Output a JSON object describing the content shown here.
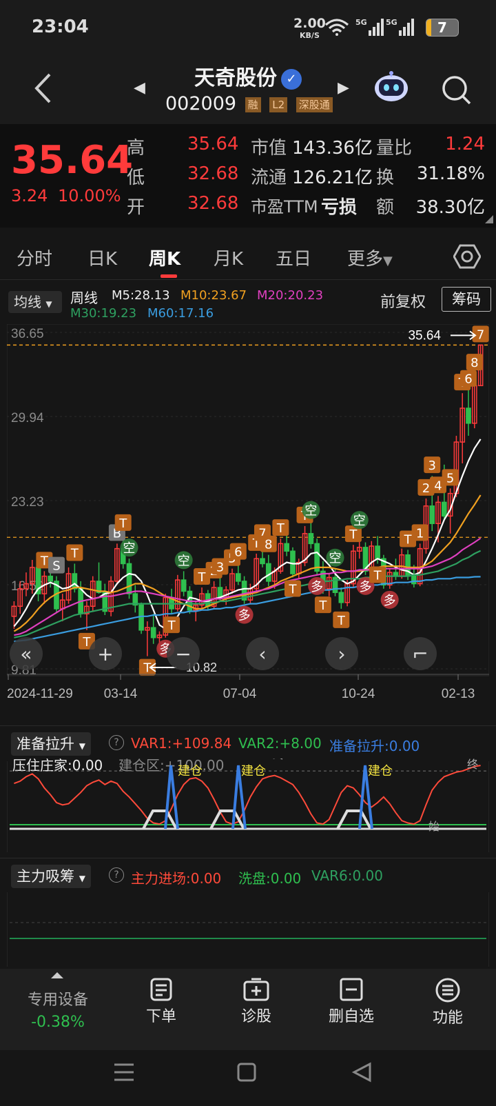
{
  "status_bar": {
    "time": "23:04",
    "net_speed": "2.00",
    "net_unit": "KB/S",
    "sim1": "5G",
    "sim2": "5G",
    "battery": "7"
  },
  "header": {
    "stock_name": "天奇股份",
    "stock_code": "002009",
    "tags": [
      "融",
      "L2",
      "深股通"
    ]
  },
  "quote": {
    "price": "35.64",
    "change": "3.24",
    "change_pct": "10.00%",
    "high_label": "高",
    "high": "35.64",
    "low_label": "低",
    "low": "32.68",
    "open_label": "开",
    "open": "32.68",
    "mcap_label": "市值",
    "mcap": "143.36亿",
    "float_label": "流通",
    "float": "126.21亿",
    "pe_label": "市盈TTM",
    "pe": "亏损",
    "vol_ratio_label": "量比",
    "vol_ratio": "1.24",
    "turnover_label": "换",
    "turnover": "31.18%",
    "amount_label": "额",
    "amount": "38.30亿"
  },
  "tabs": {
    "items": [
      "分时",
      "日K",
      "周K",
      "月K",
      "五日",
      "更多"
    ],
    "active": "周K"
  },
  "chart_header": {
    "ma_selector": "均线",
    "period": "周线",
    "m5": "M5:28.13",
    "m10": "M10:23.67",
    "m20": "M20:20.23",
    "m30": "M30:19.23",
    "m60": "M60:17.16",
    "adjust": "前复权",
    "chip_button": "筹码"
  },
  "colors": {
    "up": "#ff3b3b",
    "down": "#2fbf4f",
    "m5": "#ffffff",
    "m10": "#f0a020",
    "m20": "#e040c0",
    "m30": "#2ea060",
    "m60": "#3a9de0",
    "signal_box": "#b8621a"
  },
  "chart_data": {
    "type": "candlestick",
    "title": "周线",
    "y_ticks": [
      "36.65",
      "29.94",
      "23.23",
      "16.52",
      "9.81"
    ],
    "ylim": [
      9.81,
      36.65
    ],
    "x_ticks": [
      "2024-11-29",
      "03-14",
      "07-04",
      "10-24",
      "02-13"
    ],
    "last_price_label": "35.64",
    "low_price_label": "10.82",
    "reference_line": 20.3,
    "candles": [
      [
        14.0,
        15.2,
        13.0,
        14.8
      ],
      [
        14.8,
        16.8,
        14.2,
        16.2
      ],
      [
        16.2,
        17.5,
        15.6,
        16.6
      ],
      [
        16.6,
        18.5,
        15.8,
        17.9
      ],
      [
        17.9,
        18.3,
        15.2,
        15.8
      ],
      [
        15.8,
        17.6,
        15.0,
        17.2
      ],
      [
        17.2,
        18.6,
        16.3,
        16.8
      ],
      [
        16.8,
        17.2,
        14.3,
        14.6
      ],
      [
        14.6,
        15.8,
        13.6,
        15.3
      ],
      [
        15.3,
        17.9,
        15.0,
        17.4
      ],
      [
        17.4,
        18.2,
        15.9,
        16.2
      ],
      [
        16.2,
        16.8,
        13.9,
        14.2
      ],
      [
        14.2,
        15.2,
        12.9,
        14.8
      ],
      [
        14.8,
        17.2,
        14.4,
        16.8
      ],
      [
        16.8,
        18.3,
        15.8,
        15.9
      ],
      [
        15.9,
        16.6,
        14.1,
        14.4
      ],
      [
        14.4,
        17.2,
        14.0,
        16.8
      ],
      [
        16.8,
        19.8,
        16.5,
        19.4
      ],
      [
        19.4,
        20.6,
        17.8,
        18.2
      ],
      [
        18.2,
        18.6,
        15.4,
        15.8
      ],
      [
        15.8,
        16.5,
        14.3,
        14.9
      ],
      [
        14.9,
        15.1,
        12.6,
        12.9
      ],
      [
        12.9,
        13.6,
        10.82,
        13.1
      ],
      [
        13.1,
        14.2,
        11.8,
        12.3
      ],
      [
        12.3,
        12.8,
        11.2,
        12.5
      ],
      [
        12.5,
        15.8,
        12.3,
        15.5
      ],
      [
        15.5,
        16.2,
        14.2,
        14.6
      ],
      [
        14.6,
        17.3,
        14.4,
        16.9
      ],
      [
        16.9,
        17.6,
        15.6,
        16.0
      ],
      [
        16.0,
        16.4,
        14.2,
        14.5
      ],
      [
        14.5,
        15.2,
        13.6,
        14.9
      ],
      [
        14.9,
        16.3,
        14.6,
        15.8
      ],
      [
        15.8,
        16.1,
        14.5,
        14.8
      ],
      [
        14.8,
        16.8,
        14.6,
        16.3
      ],
      [
        16.3,
        17.1,
        15.2,
        15.5
      ],
      [
        15.5,
        16.4,
        14.9,
        16.1
      ],
      [
        16.1,
        17.8,
        15.8,
        17.4
      ],
      [
        17.4,
        18.3,
        16.5,
        16.8
      ],
      [
        16.8,
        17.2,
        15.0,
        15.3
      ],
      [
        15.3,
        16.6,
        15.0,
        16.2
      ],
      [
        16.2,
        19.0,
        16.0,
        18.6
      ],
      [
        18.6,
        19.8,
        17.9,
        18.2
      ],
      [
        18.2,
        18.9,
        16.4,
        16.8
      ],
      [
        16.8,
        17.9,
        16.2,
        17.6
      ],
      [
        17.6,
        20.2,
        17.4,
        19.8
      ],
      [
        19.8,
        20.8,
        18.8,
        19.2
      ],
      [
        19.2,
        19.5,
        17.1,
        17.4
      ],
      [
        17.4,
        18.6,
        17.0,
        18.3
      ],
      [
        18.3,
        21.2,
        18.0,
        20.6
      ],
      [
        20.6,
        21.6,
        19.4,
        19.8
      ],
      [
        19.8,
        20.2,
        17.3,
        17.6
      ],
      [
        17.6,
        18.4,
        15.8,
        16.2
      ],
      [
        16.2,
        17.4,
        15.6,
        17.1
      ],
      [
        17.1,
        17.8,
        15.6,
        15.9
      ],
      [
        15.9,
        16.3,
        14.6,
        15.1
      ],
      [
        15.1,
        16.9,
        14.8,
        16.6
      ],
      [
        16.6,
        19.7,
        16.3,
        19.2
      ],
      [
        19.2,
        20.8,
        18.6,
        19.5
      ],
      [
        19.5,
        19.9,
        17.3,
        17.6
      ],
      [
        17.6,
        20.0,
        17.4,
        19.6
      ],
      [
        19.6,
        20.4,
        18.2,
        18.6
      ],
      [
        18.6,
        18.9,
        16.2,
        16.5
      ],
      [
        16.5,
        17.8,
        16.2,
        17.5
      ],
      [
        17.5,
        18.6,
        16.9,
        17.2
      ],
      [
        17.2,
        19.4,
        17.0,
        18.9
      ],
      [
        18.9,
        19.3,
        16.9,
        17.2
      ],
      [
        17.2,
        18.1,
        16.3,
        16.6
      ],
      [
        16.6,
        19.8,
        16.4,
        19.4
      ],
      [
        19.4,
        23.4,
        19.0,
        22.8
      ],
      [
        22.8,
        25.2,
        20.8,
        21.4
      ],
      [
        21.4,
        23.6,
        19.9,
        23.1
      ],
      [
        23.1,
        26.1,
        21.6,
        22.0
      ],
      [
        22.0,
        24.2,
        20.6,
        23.8
      ],
      [
        23.8,
        28.4,
        23.5,
        27.9
      ],
      [
        27.9,
        31.8,
        26.2,
        30.6
      ],
      [
        30.6,
        32.1,
        28.4,
        29.4
      ],
      [
        29.4,
        33.4,
        29.0,
        32.4
      ],
      [
        32.4,
        35.64,
        32.4,
        35.64
      ]
    ],
    "ma_series": [
      {
        "name": "M5",
        "color": "#ffffff",
        "values": [
          13.2,
          13.8,
          14.6,
          15.5,
          16.2,
          16.5,
          16.7,
          16.5,
          16.2,
          16.3,
          16.6,
          16.2,
          15.7,
          15.4,
          15.5,
          15.8,
          15.9,
          16.6,
          17.1,
          17.4,
          17.3,
          16.8,
          15.7,
          14.5,
          13.3,
          13.0,
          13.3,
          14.0,
          14.8,
          15.5,
          15.4,
          15.2,
          15.2,
          15.4,
          15.5,
          15.7,
          15.9,
          16.1,
          16.2,
          16.2,
          16.5,
          17.0,
          17.3,
          17.6,
          18.0,
          18.3,
          18.2,
          18.2,
          18.5,
          19.0,
          19.1,
          18.6,
          18.1,
          17.4,
          16.9,
          16.6,
          16.8,
          17.3,
          17.8,
          18.3,
          18.6,
          18.4,
          18.2,
          17.9,
          17.7,
          17.6,
          17.3,
          17.5,
          18.4,
          19.4,
          20.5,
          21.7,
          22.5,
          23.9,
          25.2,
          26.4,
          27.4,
          28.13
        ]
      },
      {
        "name": "M10",
        "color": "#f0a020",
        "values": [
          12.8,
          13.1,
          13.5,
          14.0,
          14.6,
          15.1,
          15.5,
          15.8,
          16.0,
          16.1,
          16.3,
          16.3,
          16.2,
          16.1,
          16.0,
          16.0,
          15.9,
          16.0,
          16.2,
          16.4,
          16.6,
          16.6,
          16.4,
          16.2,
          15.9,
          15.6,
          15.4,
          15.2,
          15.0,
          14.8,
          14.6,
          14.6,
          14.8,
          15.0,
          15.2,
          15.4,
          15.5,
          15.6,
          15.7,
          15.8,
          15.9,
          16.1,
          16.3,
          16.5,
          16.8,
          17.0,
          17.2,
          17.4,
          17.6,
          17.8,
          17.9,
          17.9,
          17.9,
          17.8,
          17.7,
          17.6,
          17.6,
          17.6,
          17.7,
          17.8,
          17.9,
          18.0,
          18.0,
          18.0,
          18.0,
          17.9,
          17.9,
          17.9,
          18.1,
          18.4,
          18.9,
          19.4,
          19.9,
          20.6,
          21.4,
          22.2,
          22.9,
          23.67
        ]
      },
      {
        "name": "M20",
        "color": "#e040c0",
        "values": [
          12.5,
          12.6,
          12.8,
          13.1,
          13.4,
          13.7,
          14.0,
          14.3,
          14.6,
          14.8,
          15.0,
          15.2,
          15.3,
          15.4,
          15.5,
          15.6,
          15.6,
          15.7,
          15.8,
          15.9,
          16.0,
          16.0,
          15.9,
          15.8,
          15.7,
          15.6,
          15.5,
          15.4,
          15.3,
          15.2,
          15.2,
          15.2,
          15.3,
          15.4,
          15.4,
          15.5,
          15.6,
          15.7,
          15.8,
          15.9,
          16.0,
          16.1,
          16.2,
          16.4,
          16.6,
          16.8,
          16.9,
          17.0,
          17.1,
          17.2,
          17.3,
          17.4,
          17.4,
          17.5,
          17.5,
          17.6,
          17.6,
          17.7,
          17.7,
          17.7,
          17.8,
          17.8,
          17.8,
          17.8,
          17.8,
          17.8,
          17.8,
          17.8,
          17.9,
          18.0,
          18.2,
          18.4,
          18.6,
          18.9,
          19.3,
          19.6,
          19.9,
          20.23
        ]
      },
      {
        "name": "M30",
        "color": "#2ea060",
        "values": [
          12.3,
          12.4,
          12.5,
          12.7,
          12.9,
          13.1,
          13.3,
          13.5,
          13.7,
          13.9,
          14.1,
          14.2,
          14.3,
          14.4,
          14.5,
          14.6,
          14.7,
          14.8,
          14.9,
          15.0,
          15.0,
          15.0,
          15.0,
          15.0,
          15.0,
          15.0,
          15.0,
          15.0,
          15.0,
          15.0,
          15.0,
          15.0,
          15.1,
          15.1,
          15.2,
          15.2,
          15.3,
          15.4,
          15.5,
          15.6,
          15.7,
          15.8,
          15.9,
          16.0,
          16.1,
          16.2,
          16.3,
          16.4,
          16.5,
          16.6,
          16.7,
          16.8,
          16.8,
          16.9,
          16.9,
          17.0,
          17.0,
          17.0,
          17.1,
          17.1,
          17.1,
          17.2,
          17.2,
          17.2,
          17.2,
          17.2,
          17.3,
          17.3,
          17.4,
          17.5,
          17.6,
          17.8,
          18.0,
          18.2,
          18.5,
          18.7,
          19.0,
          19.23
        ]
      },
      {
        "name": "M60",
        "color": "#3a9de0",
        "values": [
          12.0,
          12.05,
          12.1,
          12.2,
          12.3,
          12.4,
          12.5,
          12.6,
          12.7,
          12.8,
          12.9,
          13.0,
          13.1,
          13.2,
          13.3,
          13.4,
          13.5,
          13.6,
          13.7,
          13.8,
          13.9,
          14.0,
          14.0,
          14.1,
          14.1,
          14.2,
          14.2,
          14.3,
          14.3,
          14.4,
          14.4,
          14.5,
          14.5,
          14.6,
          14.6,
          14.7,
          14.7,
          14.8,
          14.9,
          15.0,
          15.0,
          15.1,
          15.2,
          15.3,
          15.4,
          15.5,
          15.6,
          15.7,
          15.8,
          15.9,
          16.0,
          16.1,
          16.1,
          16.2,
          16.2,
          16.3,
          16.3,
          16.4,
          16.4,
          16.5,
          16.5,
          16.6,
          16.6,
          16.7,
          16.7,
          16.7,
          16.8,
          16.8,
          16.9,
          16.9,
          17.0,
          17.0,
          17.0,
          17.1,
          17.1,
          17.1,
          17.15,
          17.16
        ]
      }
    ],
    "signal_labels": [
      "B",
      "S",
      "T",
      "空",
      "多",
      "1",
      "2",
      "3",
      "4",
      "5",
      "6",
      "7",
      "8"
    ]
  },
  "chart_controls": [
    "«",
    "+",
    "−",
    "‹",
    "›",
    "⌐"
  ],
  "indicator1": {
    "name": "准备拉升",
    "var1": "VAR1:+109.84",
    "var2": "VAR2:+8.00",
    "ready": "准备拉升:0.00",
    "press": "压住庄家:0.00",
    "build_zone": "建仓区:+100.00",
    "label_build": "建仓",
    "label_end": "终",
    "label_start": "始",
    "series": [
      78,
      82,
      90,
      95,
      86,
      70,
      58,
      44,
      40,
      42,
      52,
      62,
      74,
      80,
      84,
      76,
      82,
      78,
      64,
      54,
      42,
      30,
      16,
      8,
      6,
      12,
      34,
      58,
      76,
      86,
      88,
      82,
      70,
      50,
      28,
      10,
      6,
      10,
      30,
      54,
      72,
      86,
      90,
      92,
      88,
      82,
      76,
      62,
      44,
      24,
      8,
      6,
      14,
      38,
      62,
      74,
      70,
      58,
      44,
      36,
      44,
      54,
      42,
      26,
      12,
      8,
      6,
      12,
      40,
      66,
      80,
      90,
      94,
      98,
      100,
      104,
      108,
      109.84
    ]
  },
  "indicator2": {
    "name": "主力吸筹",
    "inflow": "主力进场:0.00",
    "wash": "洗盘:0.00",
    "var6": "VAR6:0.00"
  },
  "bottom_nav": {
    "device_label": "专用设备",
    "device_change": "-0.38%",
    "order": "下单",
    "diagnose": "诊股",
    "remove": "删自选",
    "functions": "功能"
  }
}
